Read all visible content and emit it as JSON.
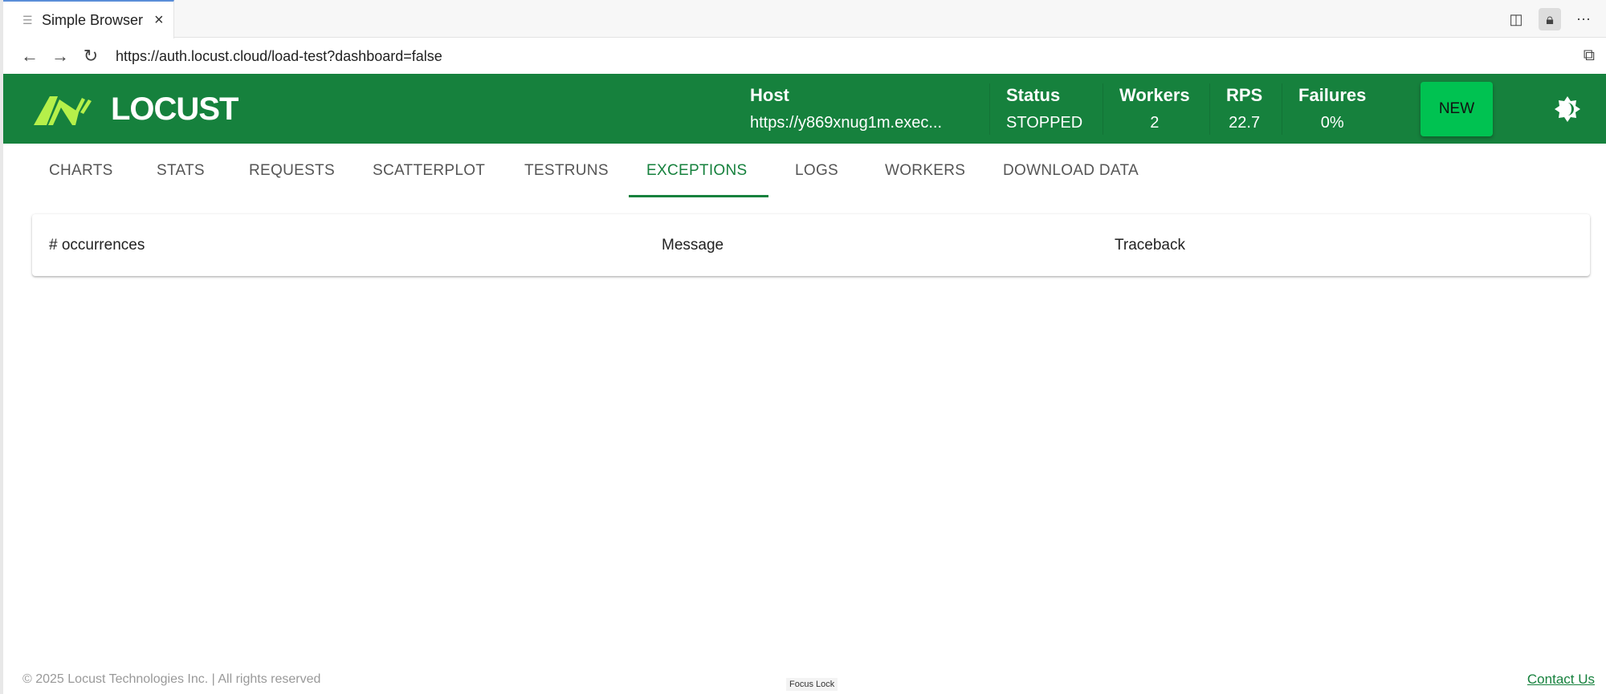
{
  "browser": {
    "tab_title": "Simple Browser",
    "url": "https://auth.locust.cloud/load-test?dashboard=false"
  },
  "header": {
    "logo_text": "LOCUST",
    "stats": [
      {
        "label": "Host",
        "value": "https://y869xnug1m.exec..."
      },
      {
        "label": "Status",
        "value": "STOPPED"
      },
      {
        "label": "Workers",
        "value": "2"
      },
      {
        "label": "RPS",
        "value": "22.7"
      },
      {
        "label": "Failures",
        "value": "0%"
      }
    ],
    "new_label": "NEW"
  },
  "nav": {
    "tabs": [
      "CHARTS",
      "STATS",
      "REQUESTS",
      "SCATTERPLOT",
      "TESTRUNS",
      "EXCEPTIONS",
      "LOGS",
      "WORKERS",
      "DOWNLOAD DATA"
    ],
    "active": "EXCEPTIONS"
  },
  "table": {
    "columns": [
      "# occurrences",
      "Message",
      "Traceback"
    ],
    "rows": []
  },
  "footer": {
    "copyright": "© 2025 Locust Technologies Inc. | All rights reserved",
    "focus_lock": "Focus Lock",
    "contact": "Contact Us"
  },
  "colors": {
    "brand": "#16813d",
    "new_button": "#00c251",
    "logo": "#b5f04a"
  }
}
